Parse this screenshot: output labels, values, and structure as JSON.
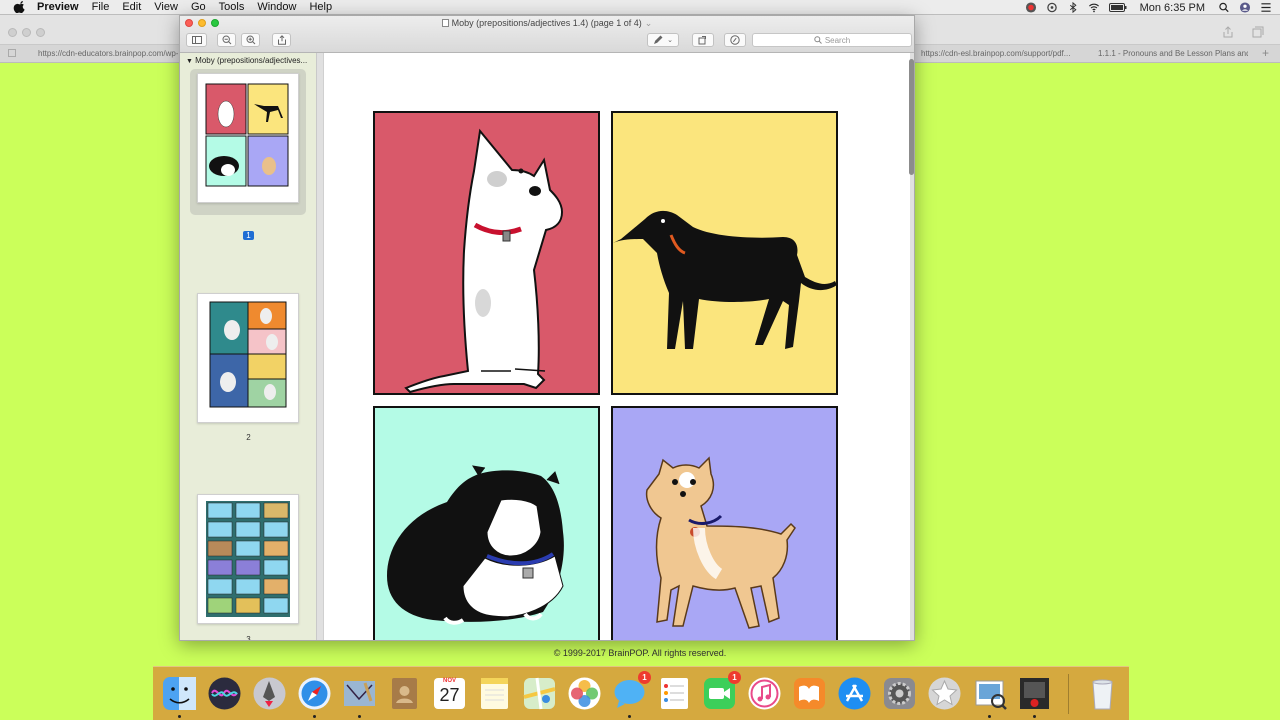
{
  "menubar": {
    "app_name": "Preview",
    "menus": [
      "File",
      "Edit",
      "View",
      "Go",
      "Tools",
      "Window",
      "Help"
    ],
    "clock": "Mon 6:35 PM"
  },
  "background_browser": {
    "tabs": [
      "https://cdn-educators.brainpop.com/wp-...",
      "https://cdn-esl.brainpop.com/support/pdf...",
      "1.1.1 - Pronouns and Be Lesson Plans and..."
    ],
    "copyright": "© 1999-2017 BrainPOP. All rights reserved."
  },
  "preview": {
    "title": "Moby (prepositions/adjectives 1.4) (page 1 of 4)",
    "search_placeholder": "Search",
    "sidebar_title": "Moby (prepositions/adjectives...",
    "pages": [
      {
        "number": "1",
        "selected": true
      },
      {
        "number": "2",
        "selected": false
      },
      {
        "number": "3",
        "selected": false
      }
    ],
    "panels": [
      {
        "name": "white-dog",
        "color": "#d9596a"
      },
      {
        "name": "black-greyhound",
        "color": "#fbe57d"
      },
      {
        "name": "bulldog",
        "color": "#b4fbe6"
      },
      {
        "name": "chihuahua",
        "color": "#a9a7f5"
      }
    ]
  },
  "dock": {
    "calendar_month": "NOV",
    "calendar_day": "27",
    "badges": {
      "messages": "1",
      "facetime": "1"
    },
    "icons": [
      "finder-icon",
      "siri-icon",
      "launchpad-icon",
      "safari-icon",
      "mail-icon",
      "contacts-icon",
      "calendar-icon",
      "notes-icon",
      "maps-icon",
      "photos-icon",
      "messages-icon",
      "reminders-icon",
      "facetime-icon",
      "itunes-icon",
      "ibooks-icon",
      "appstore-icon",
      "system-preferences-icon",
      "reeder-icon",
      "preview-icon",
      "photobooth-icon",
      "trash-icon"
    ]
  }
}
